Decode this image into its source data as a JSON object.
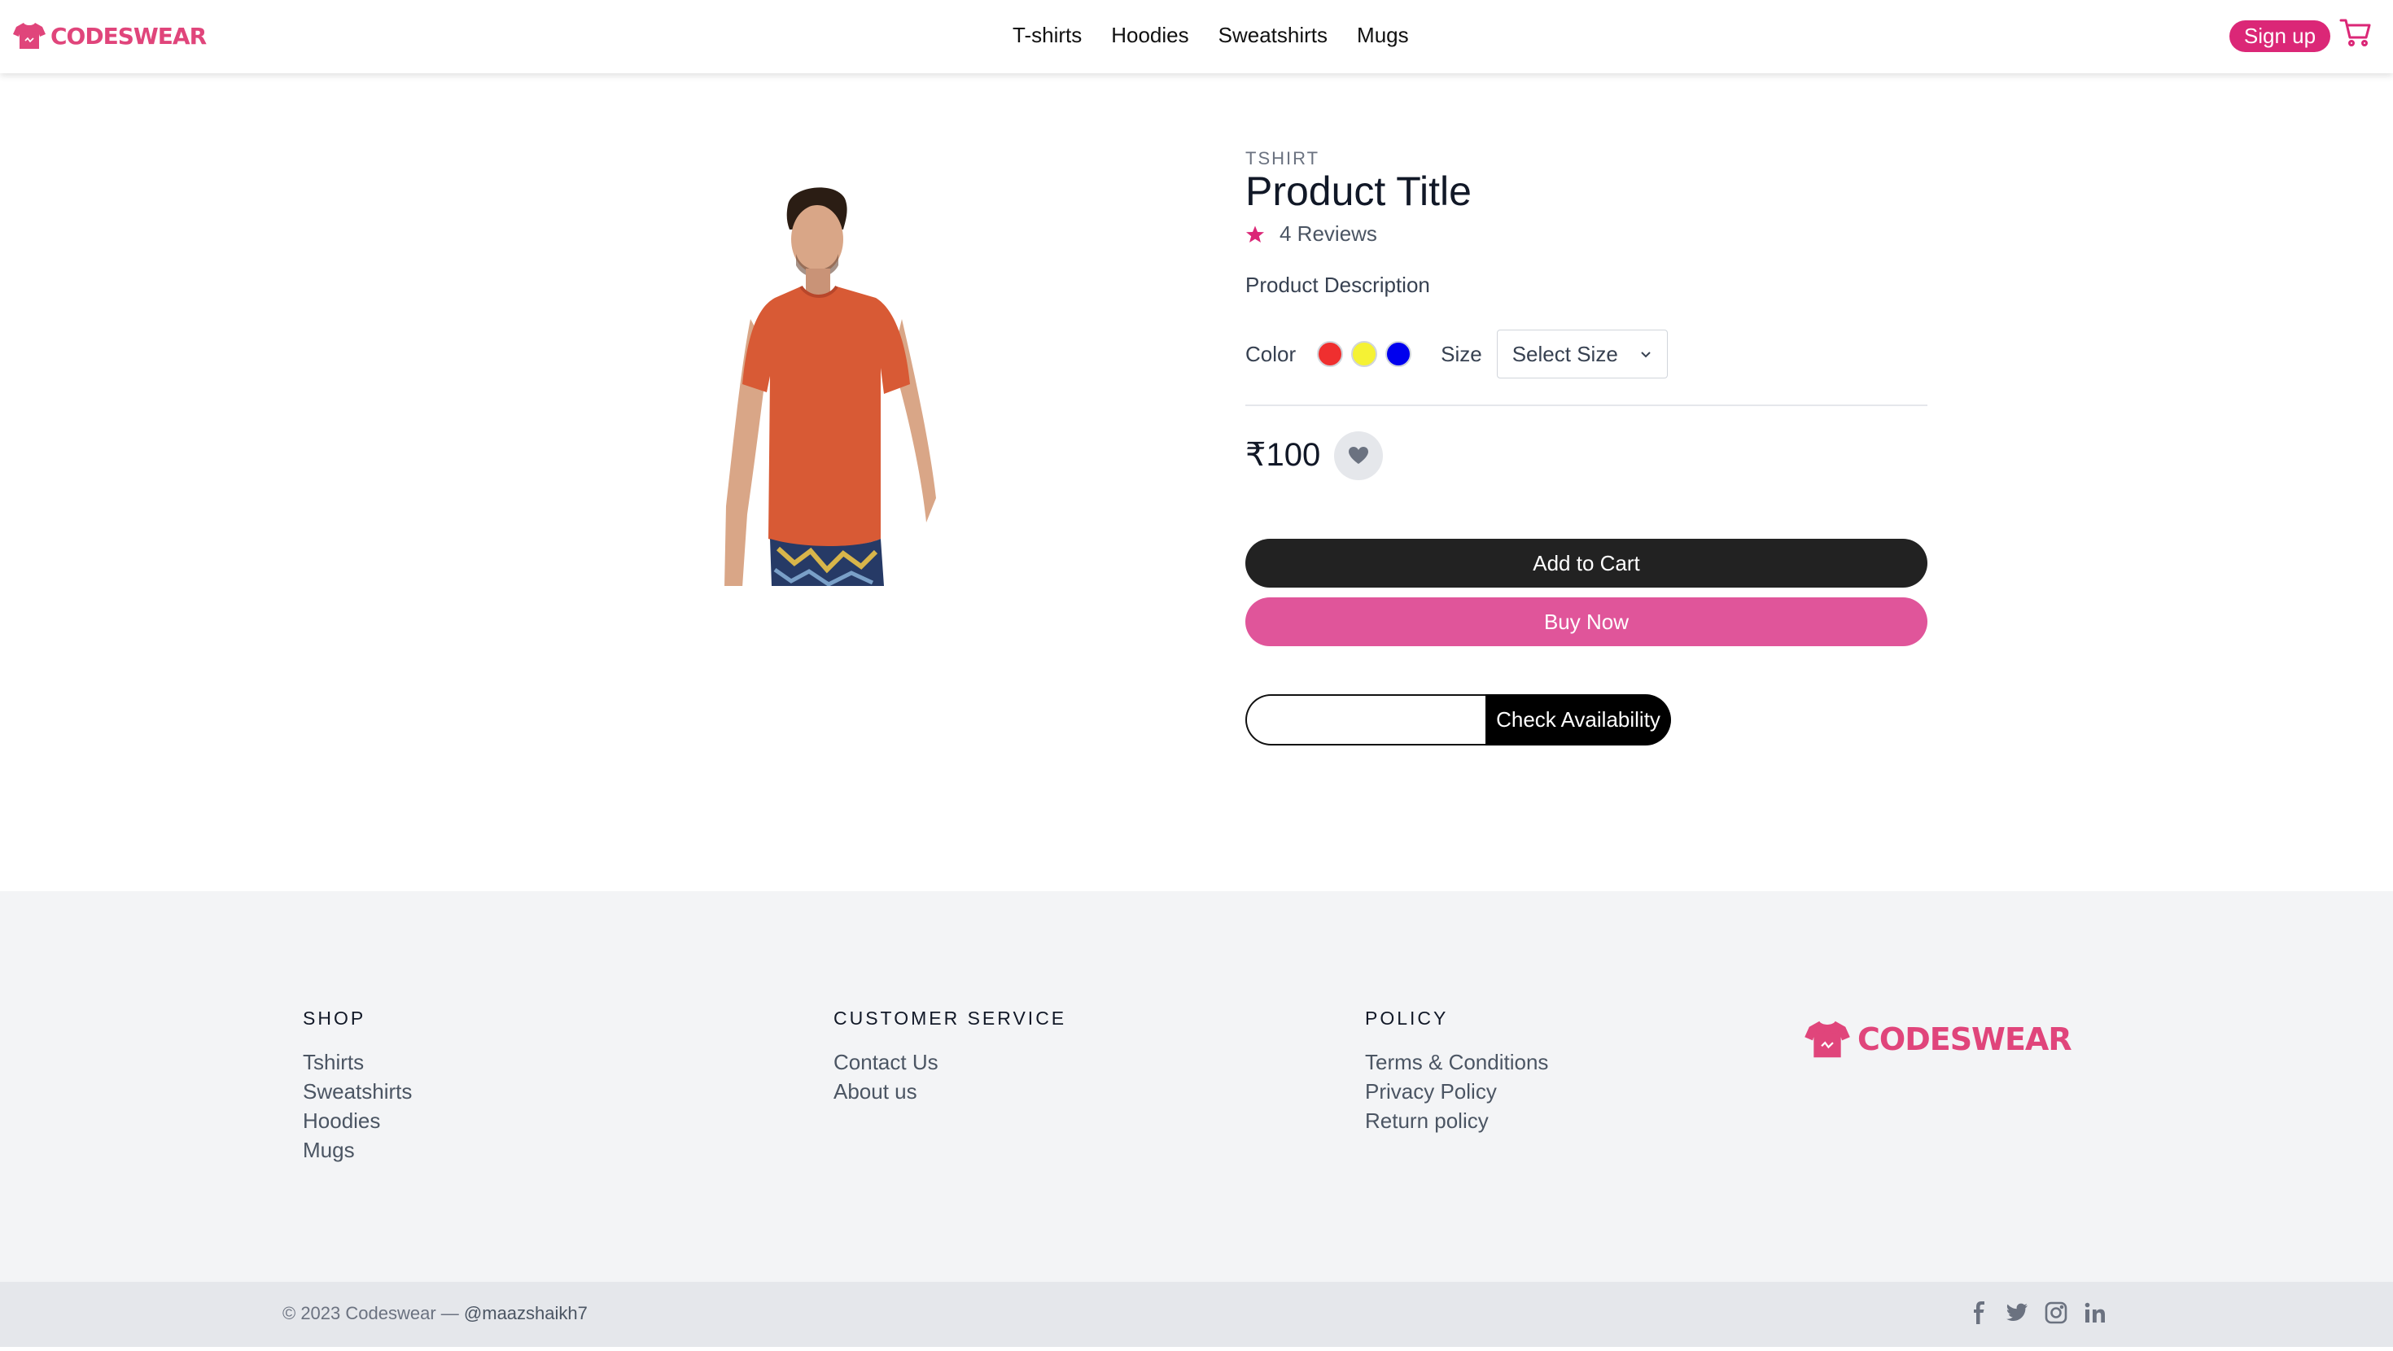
{
  "brand": {
    "name": "CODESWEAR",
    "color": "#e0457b"
  },
  "nav": {
    "links": [
      "T-shirts",
      "Hoodies",
      "Sweatshirts",
      "Mugs"
    ],
    "signup_label": "Sign up",
    "cart_icon": "cart-icon"
  },
  "product": {
    "category": "TSHIRT",
    "title": "Product Title",
    "reviews": "4 Reviews",
    "rating_icon": "star-icon",
    "description": "Product Description",
    "color_label": "Color",
    "colors": [
      "#ef2f2f",
      "#f5f234",
      "#0000ee"
    ],
    "size_label": "Size",
    "size_selected": "Select Size",
    "price": "₹100",
    "add_to_cart": "Add to Cart",
    "buy_now": "Buy Now",
    "pincode_value": "",
    "pincode_placeholder": "",
    "check_availability": "Check Availability"
  },
  "footer": {
    "columns": [
      {
        "heading": "SHOP",
        "links": [
          "Tshirts",
          "Sweatshirts",
          "Hoodies",
          "Mugs"
        ]
      },
      {
        "heading": "CUSTOMER SERVICE",
        "links": [
          "Contact Us",
          "About us"
        ]
      },
      {
        "heading": "POLICY",
        "links": [
          "Terms & Conditions",
          "Privacy Policy",
          "Return policy"
        ]
      }
    ],
    "copyright": "© 2023 Codeswear —",
    "handle": "@maazshaikh7",
    "socials": [
      "facebook-icon",
      "twitter-icon",
      "instagram-icon",
      "linkedin-icon"
    ]
  }
}
